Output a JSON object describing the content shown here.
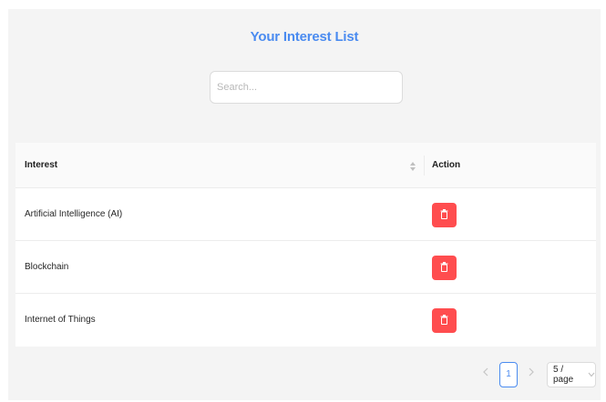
{
  "header": {
    "title": "Your Interest List"
  },
  "search": {
    "placeholder": "Search...",
    "value": ""
  },
  "table": {
    "columns": {
      "interest": "Interest",
      "action": "Action"
    },
    "rows": [
      {
        "interest": "Artificial Intelligence (AI)"
      },
      {
        "interest": "Blockchain"
      },
      {
        "interest": "Internet of Things"
      }
    ]
  },
  "pagination": {
    "current_page": "1",
    "page_size_label": "5 / page"
  },
  "icons": {
    "sort": "sort-icon",
    "delete": "trash-icon",
    "prev": "chevron-left-icon",
    "next": "chevron-right-icon",
    "dropdown": "chevron-down-icon"
  },
  "colors": {
    "accent": "#4a8bf0",
    "danger": "#ff4d4f",
    "panel_bg": "#f4f4f4"
  }
}
